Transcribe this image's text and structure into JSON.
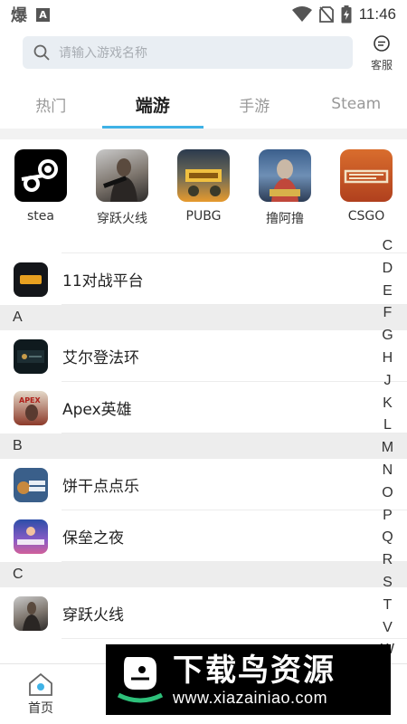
{
  "status": {
    "time": "11:46",
    "left_char": "爆",
    "left_badge": "A"
  },
  "search": {
    "placeholder": "请输入游戏名称",
    "service_label": "客服"
  },
  "tabs": [
    {
      "label": "热门",
      "active": false
    },
    {
      "label": "端游",
      "active": true
    },
    {
      "label": "手游",
      "active": false
    },
    {
      "label": "Steam",
      "active": false
    }
  ],
  "featured": [
    {
      "name": "stea",
      "icon": "steam-icon"
    },
    {
      "name": "穿跃火线",
      "icon": "crossfire-icon"
    },
    {
      "name": "PUBG",
      "icon": "pubg-icon"
    },
    {
      "name": "撸阿撸",
      "icon": "lol-icon"
    },
    {
      "name": "CSGO",
      "icon": "csgo-icon"
    }
  ],
  "list": {
    "top_item": {
      "name": "11对战平台"
    },
    "sections": [
      {
        "letter": "A",
        "items": [
          {
            "name": "艾尔登法环"
          },
          {
            "name": "Apex英雄"
          }
        ]
      },
      {
        "letter": "B",
        "items": [
          {
            "name": "饼干点点乐"
          },
          {
            "name": "保垒之夜"
          }
        ]
      },
      {
        "letter": "C",
        "items": [
          {
            "name": "穿跃火线"
          }
        ]
      }
    ]
  },
  "alphabet": [
    "C",
    "D",
    "E",
    "F",
    "G",
    "H",
    "J",
    "K",
    "L",
    "M",
    "N",
    "O",
    "P",
    "Q",
    "R",
    "S",
    "T",
    "V",
    "W"
  ],
  "bottom_nav": [
    {
      "label": "首页",
      "icon": "home-icon"
    }
  ],
  "watermark": {
    "title": "下载鸟资源",
    "url": "www.xiazainiao.com"
  },
  "colors": {
    "accent": "#3fb2e6",
    "section_bg": "#ededed",
    "search_bg": "#e9eef3"
  }
}
